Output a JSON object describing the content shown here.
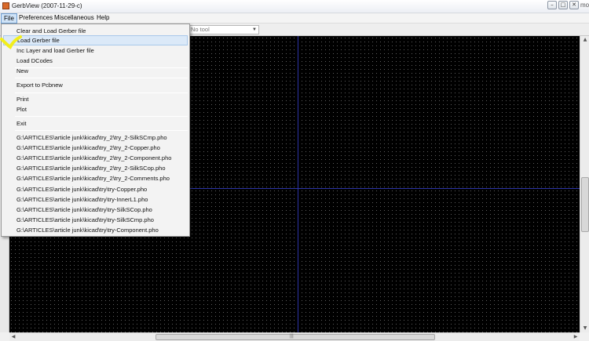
{
  "window": {
    "title": "GerbView (2007-11-29-c)",
    "minimize_glyph": "–",
    "maximize_glyph": "□",
    "close_glyph": "✕",
    "edge_text": "mo"
  },
  "menubar": {
    "items": [
      "File",
      "Preferences",
      "Miscellaneous",
      "Help"
    ]
  },
  "toolbar": {
    "tool_select_value": "No tool"
  },
  "file_menu": {
    "items": [
      "Clear and Load Gerber file",
      "Load Gerber file",
      "Inc Layer and load Gerber file",
      "Load DCodes",
      "New",
      "Export to Pcbnew",
      "Print",
      "Plot",
      "Exit"
    ],
    "recent_files": [
      "G:\\ARTICLES\\article junk\\kicad\\try_2\\try_2-SilkSCmp.pho",
      "G:\\ARTICLES\\article junk\\kicad\\try_2\\try_2-Copper.pho",
      "G:\\ARTICLES\\article junk\\kicad\\try_2\\try_2-Component.pho",
      "G:\\ARTICLES\\article junk\\kicad\\try_2\\try_2-SilkSCop.pho",
      "G:\\ARTICLES\\article junk\\kicad\\try_2\\try_2-Comments.pho",
      "G:\\ARTICLES\\article junk\\kicad\\try\\try-Copper.pho",
      "G:\\ARTICLES\\article junk\\kicad\\try\\try-InnerL1.pho",
      "G:\\ARTICLES\\article junk\\kicad\\try\\try-SilkSCop.pho",
      "G:\\ARTICLES\\article junk\\kicad\\try\\try-SilkSCmp.pho",
      "G:\\ARTICLES\\article junk\\kicad\\try\\try-Component.pho"
    ],
    "highlighted_item": "Load Gerber file"
  },
  "scrollbars": {
    "up_glyph": "▲",
    "down_glyph": "▼",
    "left_glyph": "◀",
    "right_glyph": "▶",
    "grip_glyph": "|||"
  },
  "colors": {
    "canvas_background": "#000000",
    "grid_dot": "#5f5f5f",
    "crosshair": "#2d35a8",
    "menu_highlight": "#dbe9f8",
    "annotation_mark": "#f2ee1b"
  },
  "icons": {
    "app": "gerbview-app-icon",
    "annotation": "yellow-highlighter-mark"
  }
}
